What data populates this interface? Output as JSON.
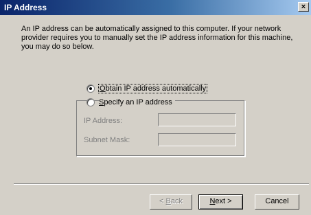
{
  "window": {
    "title": "IP Address",
    "close_glyph": "×"
  },
  "intro_text": "An IP address can be automatically assigned to this computer. If your network provider requires you to manually set the IP address information for this machine, you may do so below.",
  "options": {
    "auto": {
      "accel": "O",
      "rest": "btain IP address automatically",
      "selected": true
    },
    "manual": {
      "accel": "S",
      "rest": "pecify an IP address",
      "selected": false
    }
  },
  "fields": {
    "ip_label": "IP Address:",
    "ip_value": "",
    "mask_label": "Subnet Mask:",
    "mask_value": ""
  },
  "buttons": {
    "back": {
      "accel": "B",
      "prefix": "< ",
      "rest": "ack",
      "enabled": false
    },
    "next": {
      "accel": "N",
      "rest": "ext >",
      "enabled": true
    },
    "cancel": {
      "label": "Cancel",
      "enabled": true
    }
  }
}
